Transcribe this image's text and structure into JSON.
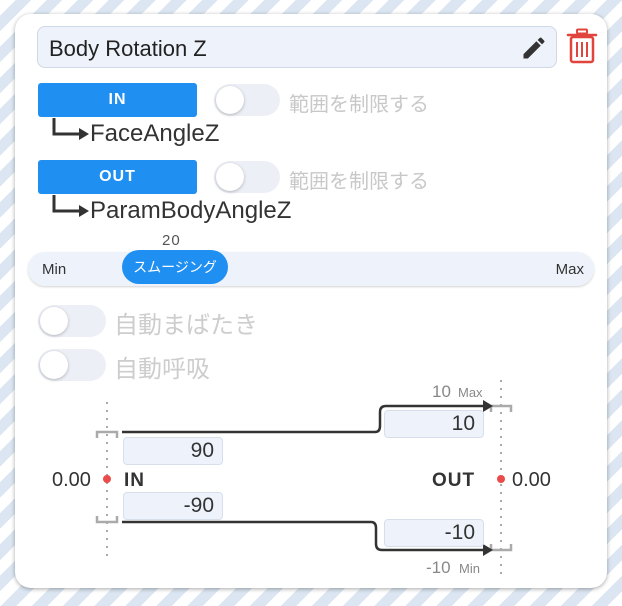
{
  "title": {
    "value": "Body Rotation Z"
  },
  "input": {
    "button_label": "IN",
    "toggle_label": "範囲を制限する",
    "param_name": "FaceAngleZ"
  },
  "output": {
    "button_label": "OUT",
    "toggle_label": "範囲を制限する",
    "param_name": "ParamBodyAngleZ"
  },
  "smoothing": {
    "value_label": "20",
    "thumb_label": "スムージング",
    "min_label": "Min",
    "max_label": "Max",
    "level": 0.2
  },
  "options": {
    "auto_blink_label": "自動まばたき",
    "auto_breath_label": "自動呼吸"
  },
  "graph": {
    "in_label": "IN",
    "out_label": "OUT",
    "in_value": "0.00",
    "out_value": "0.00",
    "in_max": "90",
    "in_min": "-90",
    "out_max": "10",
    "out_min": "-10",
    "out_max_caption_num": "10",
    "out_max_caption_text": "Max",
    "out_min_caption_num": "-10",
    "out_min_caption_text": "Min"
  },
  "colors": {
    "accent": "#1f8ff2",
    "trash": "#e0443c",
    "indicator": "#ea4b4b"
  }
}
